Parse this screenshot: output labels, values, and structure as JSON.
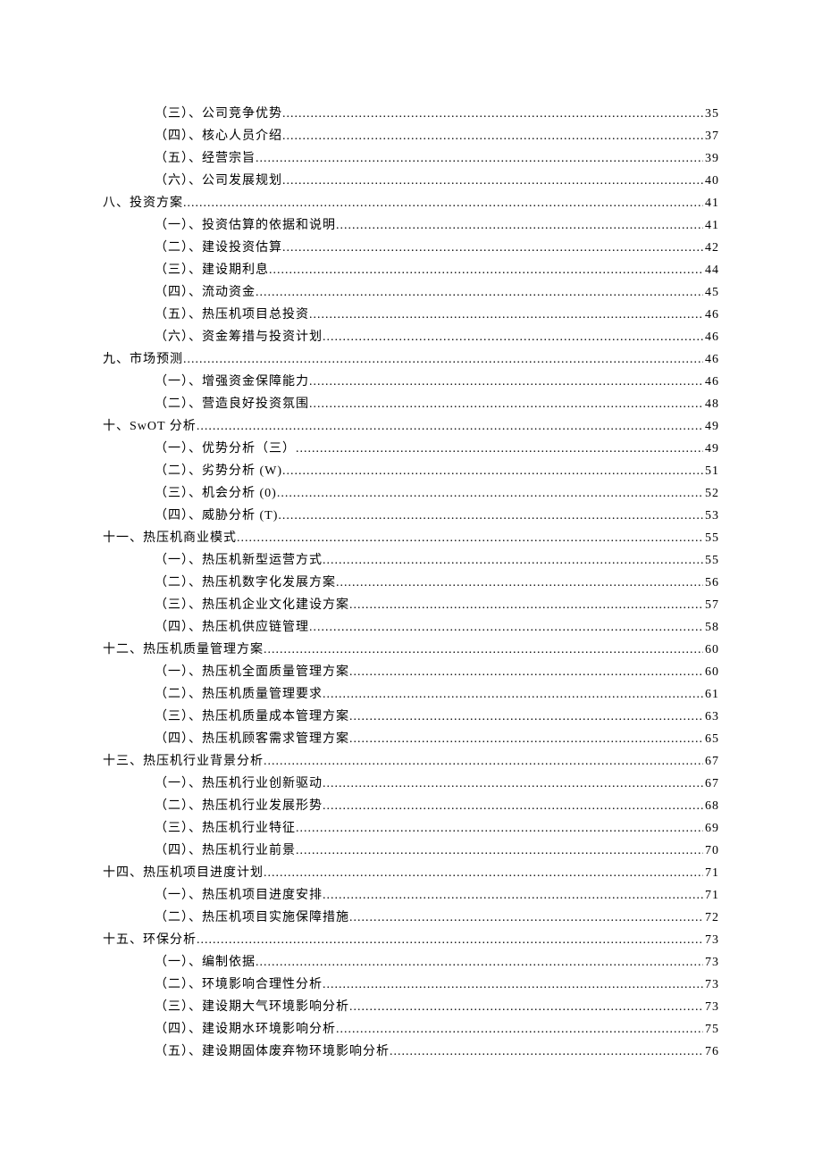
{
  "toc": [
    {
      "level": 2,
      "label": "（三）、公司竞争优势",
      "page": "35"
    },
    {
      "level": 2,
      "label": "（四）、核心人员介绍",
      "page": "37"
    },
    {
      "level": 2,
      "label": "（五）、经营宗旨",
      "page": "39"
    },
    {
      "level": 2,
      "label": "（六）、公司发展规划",
      "page": "40"
    },
    {
      "level": 1,
      "label": "八、投资方案 ",
      "page": "41"
    },
    {
      "level": 2,
      "label": "（一）、投资估算的依据和说明",
      "page": "41"
    },
    {
      "level": 2,
      "label": "（二）、建设投资估算",
      "page": "42"
    },
    {
      "level": 2,
      "label": "（三）、建设期利息",
      "page": "44"
    },
    {
      "level": 2,
      "label": "（四）、流动资金",
      "page": "45"
    },
    {
      "level": 2,
      "label": "（五）、热压机项目总投资",
      "page": "46"
    },
    {
      "level": 2,
      "label": "（六）、资金筹措与投资计划",
      "page": "46"
    },
    {
      "level": 1,
      "label": "九、市场预测 ",
      "page": "46"
    },
    {
      "level": 2,
      "label": "（一）、增强资金保障能力",
      "page": "46"
    },
    {
      "level": 2,
      "label": "（二）、营造良好投资氛围",
      "page": "48"
    },
    {
      "level": 1,
      "label": "十、SwOT 分析 ",
      "page": "49"
    },
    {
      "level": 2,
      "label": "（一）、优势分析（三）",
      "page": "49"
    },
    {
      "level": 2,
      "label": "（二）、劣势分析 (W) ",
      "page": "51"
    },
    {
      "level": 2,
      "label": "（三）、机会分析 (0) ",
      "page": "52"
    },
    {
      "level": 2,
      "label": "（四）、威胁分析 (T) ",
      "page": "53"
    },
    {
      "level": 1,
      "label": "十一、热压机商业模式 ",
      "page": "55"
    },
    {
      "level": 2,
      "label": "（一）、热压机新型运营方式",
      "page": "55"
    },
    {
      "level": 2,
      "label": "（二）、热压机数字化发展方案",
      "page": "56"
    },
    {
      "level": 2,
      "label": "（三）、热压机企业文化建设方案",
      "page": "57"
    },
    {
      "level": 2,
      "label": "（四）、热压机供应链管理",
      "page": "58"
    },
    {
      "level": 1,
      "label": "十二、热压机质量管理方案 ",
      "page": "60"
    },
    {
      "level": 2,
      "label": "（一）、热压机全面质量管理方案",
      "page": "60"
    },
    {
      "level": 2,
      "label": "（二）、热压机质量管理要求",
      "page": "61"
    },
    {
      "level": 2,
      "label": "（三）、热压机质量成本管理方案",
      "page": "63"
    },
    {
      "level": 2,
      "label": "（四）、热压机顾客需求管理方案",
      "page": "65"
    },
    {
      "level": 1,
      "label": "十三、热压机行业背景分析 ",
      "page": "67"
    },
    {
      "level": 2,
      "label": "（一）、热压机行业创新驱动",
      "page": "67"
    },
    {
      "level": 2,
      "label": "（二）、热压机行业发展形势",
      "page": "68"
    },
    {
      "level": 2,
      "label": "（三）、热压机行业特征",
      "page": "69"
    },
    {
      "level": 2,
      "label": "（四）、热压机行业前景",
      "page": "70"
    },
    {
      "level": 1,
      "label": "十四、热压机项目进度计划 ",
      "page": "71"
    },
    {
      "level": 2,
      "label": "（一）、热压机项目进度安排",
      "page": "71"
    },
    {
      "level": 2,
      "label": "（二）、热压机项目实施保障措施",
      "page": "72"
    },
    {
      "level": 1,
      "label": "十五、环保分析 ",
      "page": "73"
    },
    {
      "level": 2,
      "label": "（一）、编制依据",
      "page": "73"
    },
    {
      "level": 2,
      "label": "（二）、环境影响合理性分析",
      "page": "73"
    },
    {
      "level": 2,
      "label": "（三）、建设期大气环境影响分析",
      "page": "73"
    },
    {
      "level": 2,
      "label": "（四）、建设期水环境影响分析",
      "page": "75"
    },
    {
      "level": 2,
      "label": "（五）、建设期固体废弃物环境影响分析",
      "page": "76"
    }
  ]
}
